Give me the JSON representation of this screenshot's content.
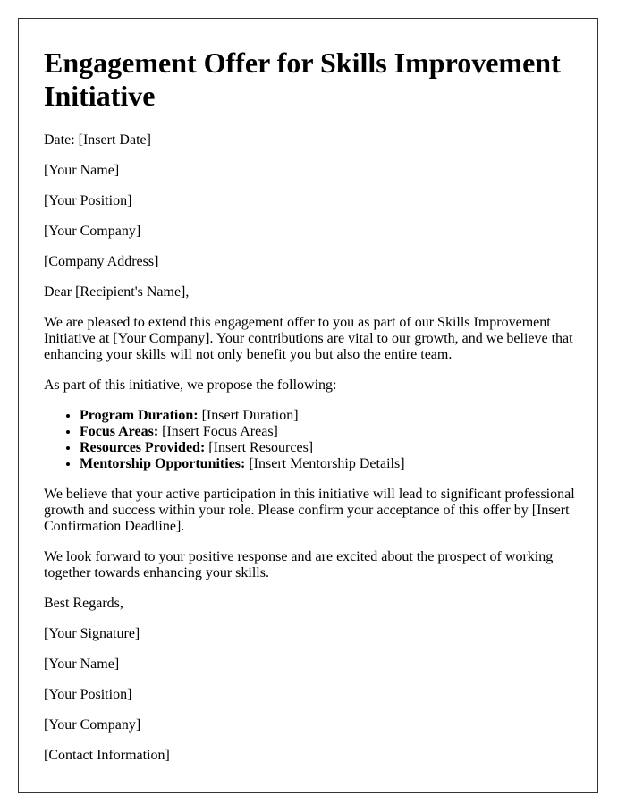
{
  "document": {
    "title": "Engagement Offer for Skills Improvement Initiative",
    "date_line": "Date: [Insert Date]",
    "sender": {
      "name": "[Your Name]",
      "position": "[Your Position]",
      "company": "[Your Company]",
      "address": "[Company Address]"
    },
    "salutation": "Dear [Recipient's Name],",
    "intro_paragraph": "We are pleased to extend this engagement offer to you as part of our Skills Improvement Initiative at [Your Company]. Your contributions are vital to our growth, and we believe that enhancing your skills will not only benefit you but also the entire team.",
    "proposal_lead": "As part of this initiative, we propose the following:",
    "terms": [
      {
        "label": "Program Duration:",
        "value": " [Insert Duration]"
      },
      {
        "label": "Focus Areas:",
        "value": " [Insert Focus Areas]"
      },
      {
        "label": "Resources Provided:",
        "value": " [Insert Resources]"
      },
      {
        "label": "Mentorship Opportunities:",
        "value": " [Insert Mentorship Details]"
      }
    ],
    "belief_paragraph": "We believe that your active participation in this initiative will lead to significant professional growth and success within your role. Please confirm your acceptance of this offer by [Insert Confirmation Deadline].",
    "closing_paragraph": "We look forward to your positive response and are excited about the prospect of working together towards enhancing your skills.",
    "sign_off": "Best Regards,",
    "signature_block": {
      "signature": "[Your Signature]",
      "name": "[Your Name]",
      "position": "[Your Position]",
      "company": "[Your Company]",
      "contact": "[Contact Information]"
    }
  }
}
